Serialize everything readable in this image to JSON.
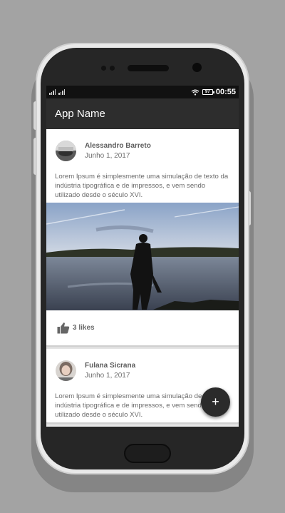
{
  "status_bar": {
    "battery": "97",
    "time": "00:55",
    "icons": [
      "signal-icon",
      "signal-icon",
      "wifi-icon",
      "battery-icon"
    ]
  },
  "app_bar": {
    "title": "App Name"
  },
  "posts": [
    {
      "author": "Alessandro Barreto",
      "date": "Junho 1, 2017",
      "text": "Lorem Ipsum é simplesmente uma simulação de texto da indústria tipográfica e de impressos, e vem sendo utilizado desde o século XVI.",
      "likes": "3 likes"
    },
    {
      "author": "Fulana Sicrana",
      "date": "Junho 1, 2017",
      "text": "Lorem Ipsum é simplesmente uma simulação de texto da indústria tipográfica e de impressos, e vem sendo utilizado desde o século XVI."
    }
  ],
  "fab": {
    "label": "+",
    "icon": "plus-icon"
  },
  "colors": {
    "app_bar": "#2d2d2d",
    "status_bar": "#111111",
    "fab": "#2b2b2b",
    "background": "#a3a3a3"
  }
}
